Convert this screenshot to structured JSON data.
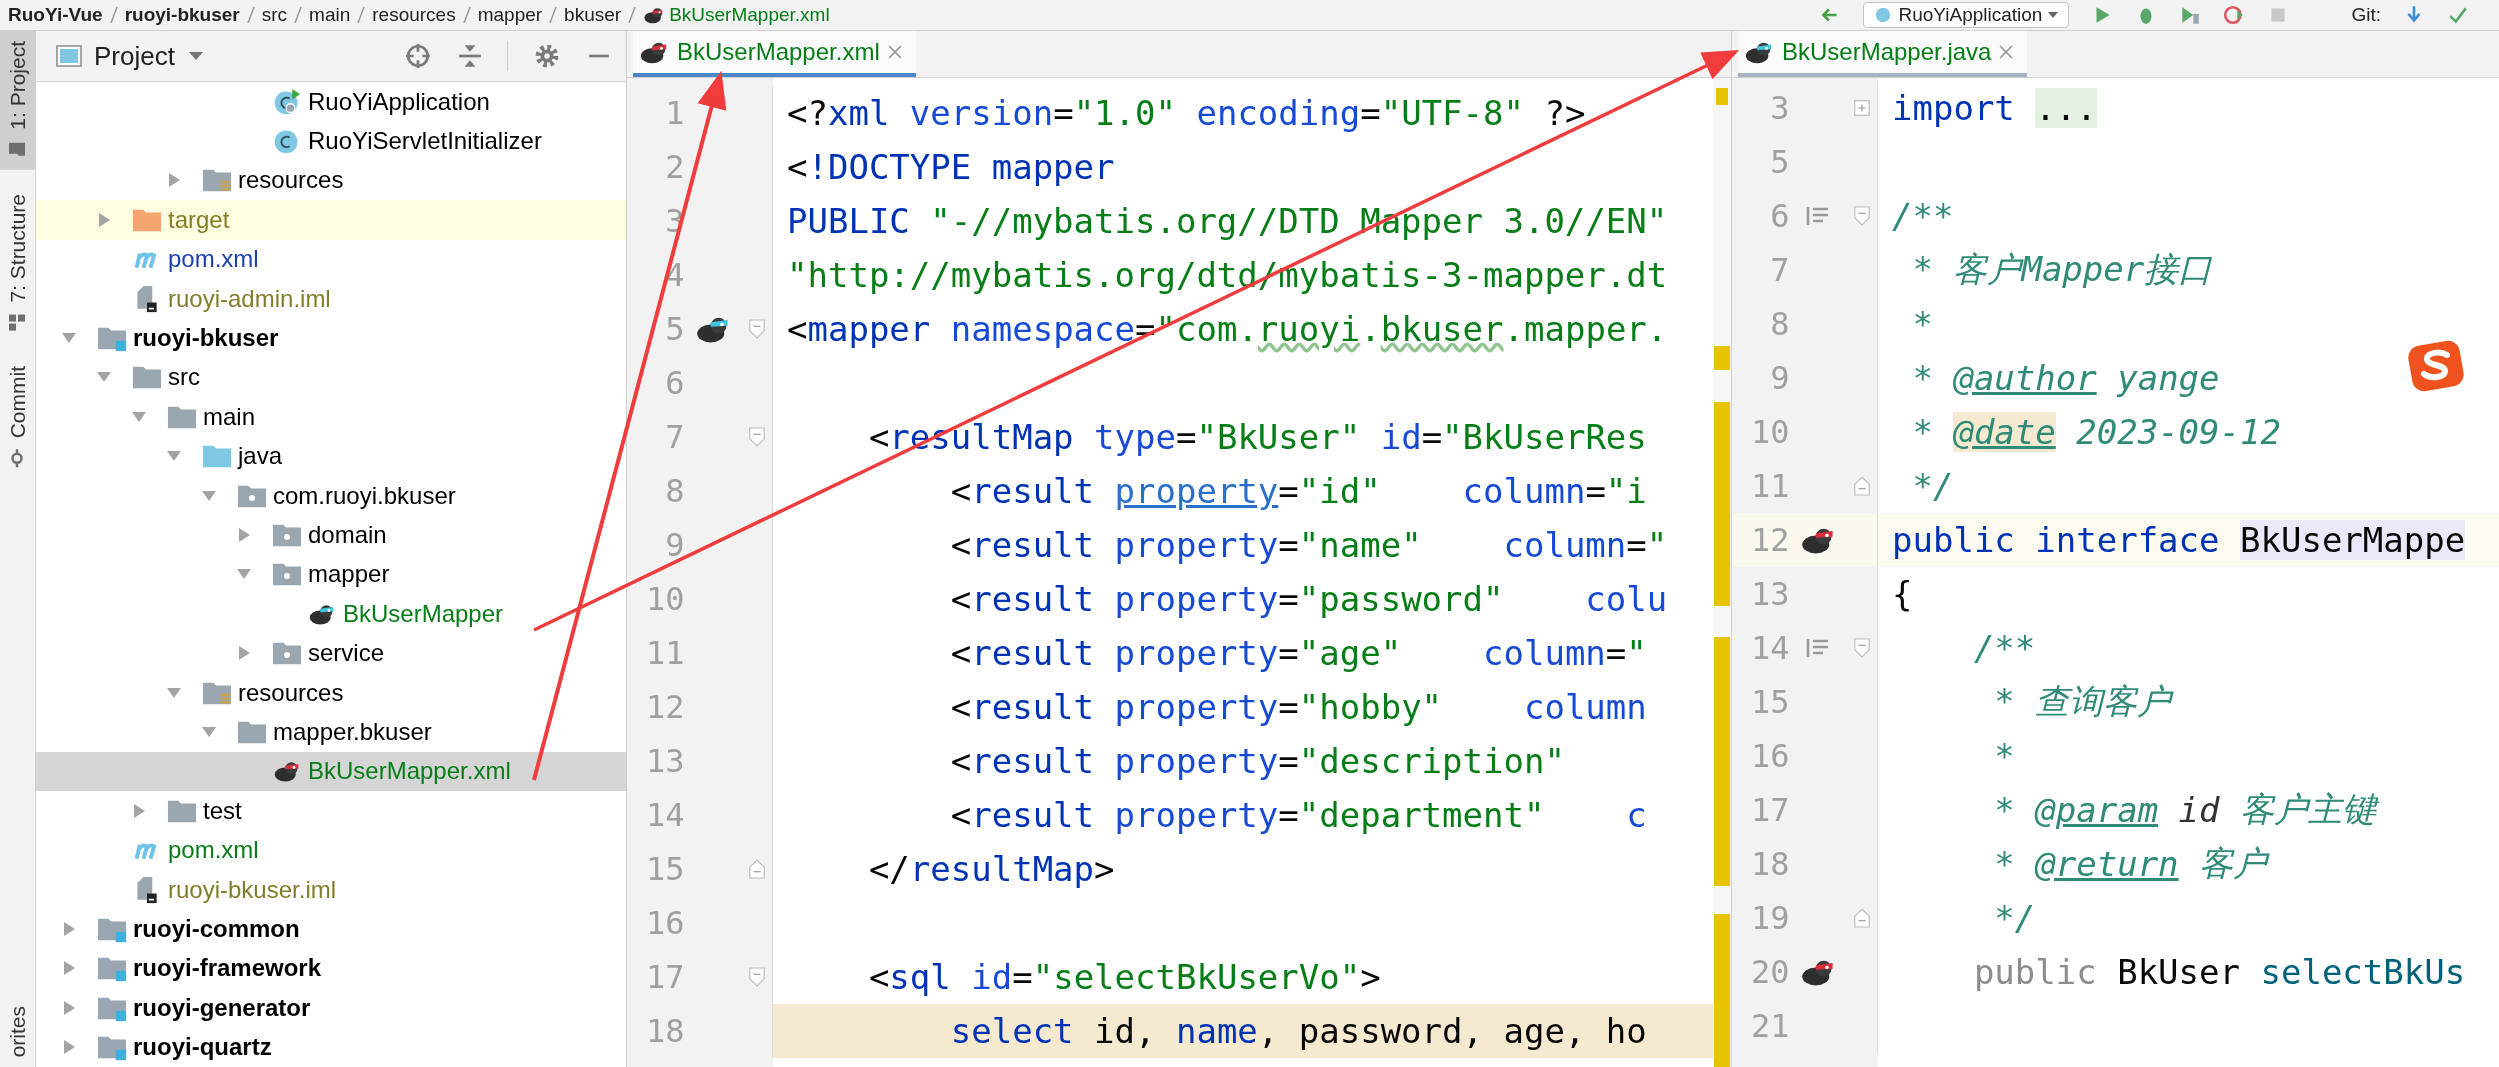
{
  "navbar": {
    "breadcrumbs": [
      {
        "label": "RuoYi-Vue",
        "kind": "project"
      },
      {
        "label": "ruoyi-bkuser",
        "kind": "module"
      },
      {
        "label": "src",
        "kind": "folder"
      },
      {
        "label": "main",
        "kind": "folder"
      },
      {
        "label": "resources",
        "kind": "folder"
      },
      {
        "label": "mapper",
        "kind": "folder"
      },
      {
        "label": "bkuser",
        "kind": "folder"
      },
      {
        "label": "BkUserMapper.xml",
        "kind": "file"
      }
    ],
    "run_config": "RuoYiApplication",
    "vcs_label": "Git:"
  },
  "tool_strip": [
    {
      "label": "1: Project",
      "kind": "project",
      "selected": true
    },
    {
      "label": "7: Structure",
      "kind": "structure",
      "selected": false
    },
    {
      "label": "Commit",
      "kind": "commit",
      "selected": false
    },
    {
      "label": "orites",
      "kind": "favorites",
      "selected": false
    }
  ],
  "project": {
    "title": "Project",
    "tree": [
      {
        "kind": "hidden",
        "children": [
          {
            "kind": "hidden",
            "children": [
              {
                "kind": "hidden",
                "children": [
                  {
                    "kind": "hidden",
                    "children": [
                      {
                        "kind": "hidden",
                        "children": [
                          {
                            "label": "RuoYiApplication",
                            "kind": "spring-class",
                            "color": "#000000",
                            "selected": false
                          },
                          {
                            "label": "RuoYiServletInitializer",
                            "kind": "class",
                            "color": "#000000",
                            "selected": false
                          }
                        ]
                      }
                    ]
                  },
                  {
                    "label": "resources",
                    "kind": "resources-folder",
                    "expanded": false,
                    "color": "#000000",
                    "selected": false
                  }
                ]
              }
            ]
          },
          {
            "label": "target",
            "kind": "excluded-folder",
            "expanded": false,
            "color": "#827d28",
            "selected": false
          },
          {
            "label": "pom.xml",
            "kind": "maven",
            "color": "#1a3fb0",
            "selected": false
          },
          {
            "label": "ruoyi-admin.iml",
            "kind": "iml",
            "color": "#827d28",
            "selected": false
          }
        ]
      },
      {
        "label": "ruoyi-bkuser",
        "kind": "module",
        "expanded": true,
        "color": "#000000",
        "selected": false,
        "children": [
          {
            "label": "src",
            "kind": "folder",
            "expanded": true,
            "color": "#000000",
            "selected": false,
            "children": [
              {
                "label": "main",
                "kind": "folder",
                "expanded": true,
                "color": "#000000",
                "selected": false,
                "children": [
                  {
                    "label": "java",
                    "kind": "source-folder",
                    "expanded": true,
                    "color": "#000000",
                    "selected": false,
                    "children": [
                      {
                        "label": "com.ruoyi.bkuser",
                        "kind": "package",
                        "expanded": true,
                        "color": "#000000",
                        "selected": false,
                        "children": [
                          {
                            "label": "domain",
                            "kind": "package",
                            "expanded": false,
                            "color": "#000000",
                            "selected": false
                          },
                          {
                            "label": "mapper",
                            "kind": "package",
                            "expanded": true,
                            "color": "#000000",
                            "selected": false,
                            "children": [
                              {
                                "label": "BkUserMapper",
                                "kind": "mybatis-java",
                                "color": "#067d17",
                                "selected": false
                              }
                            ]
                          },
                          {
                            "label": "service",
                            "kind": "package",
                            "expanded": false,
                            "color": "#000000",
                            "selected": false
                          }
                        ]
                      }
                    ]
                  },
                  {
                    "label": "resources",
                    "kind": "resources-folder",
                    "expanded": true,
                    "color": "#000000",
                    "selected": false,
                    "children": [
                      {
                        "label": "mapper.bkuser",
                        "kind": "folder",
                        "expanded": true,
                        "color": "#000000",
                        "selected": false,
                        "children": [
                          {
                            "label": "BkUserMapper.xml",
                            "kind": "mybatis-xml",
                            "color": "#067d17",
                            "selected": true
                          }
                        ]
                      }
                    ]
                  }
                ]
              },
              {
                "label": "test",
                "kind": "folder",
                "expanded": false,
                "color": "#000000",
                "selected": false
              }
            ]
          },
          {
            "label": "pom.xml",
            "kind": "maven",
            "color": "#067d17",
            "selected": false
          },
          {
            "label": "ruoyi-bkuser.iml",
            "kind": "iml",
            "color": "#827d28",
            "selected": false
          }
        ]
      },
      {
        "label": "ruoyi-common",
        "kind": "module",
        "expanded": false,
        "color": "#000000",
        "selected": false
      },
      {
        "label": "ruoyi-framework",
        "kind": "module",
        "expanded": false,
        "color": "#000000",
        "selected": false
      },
      {
        "label": "ruoyi-generator",
        "kind": "module",
        "expanded": false,
        "color": "#000000",
        "selected": false
      },
      {
        "label": "ruoyi-quartz",
        "kind": "module",
        "expanded": false,
        "color": "#000000",
        "selected": false
      }
    ]
  },
  "editors": [
    {
      "tab": {
        "label": "BkUserMapper.xml",
        "kind": "mybatis-xml",
        "color": "#067d17",
        "selected": true,
        "focused": true
      },
      "lines": [
        {
          "number": "1",
          "current": false,
          "injected": false,
          "tokens": [
            {
              "text": "<?",
              "kind": "punct"
            },
            {
              "text": "xml ",
              "kind": "tag"
            },
            {
              "text": "version",
              "kind": "attr"
            },
            {
              "text": "=",
              "kind": "punct"
            },
            {
              "text": "\"1.0\" ",
              "kind": "value"
            },
            {
              "text": "encoding",
              "kind": "attr"
            },
            {
              "text": "=",
              "kind": "punct"
            },
            {
              "text": "\"UTF-8\" ",
              "kind": "value"
            },
            {
              "text": "?>",
              "kind": "punct"
            }
          ]
        },
        {
          "number": "2",
          "current": false,
          "injected": false,
          "tokens": [
            {
              "text": "<",
              "kind": "punct"
            },
            {
              "text": "!DOCTYPE mapper",
              "kind": "tag"
            }
          ]
        },
        {
          "number": "3",
          "current": false,
          "injected": false,
          "tokens": [
            {
              "text": "PUBLIC ",
              "kind": "tag"
            },
            {
              "text": "\"-//mybatis.org//DTD Mapper 3.0//EN\"",
              "kind": "value"
            }
          ]
        },
        {
          "number": "4",
          "current": false,
          "injected": false,
          "tokens": [
            {
              "text": "\"http://mybatis.org/dtd/mybatis-3-mapper.dt",
              "kind": "value"
            }
          ]
        },
        {
          "number": "5",
          "current": false,
          "injected": false,
          "gutter_icon": {
            "kind": "mybatis-java"
          },
          "fold": {
            "kind": "start"
          },
          "tokens": [
            {
              "text": "<",
              "kind": "punct"
            },
            {
              "text": "mapper ",
              "kind": "tag"
            },
            {
              "text": "namespace",
              "kind": "attr"
            },
            {
              "text": "=",
              "kind": "punct"
            },
            {
              "text": "\"com.",
              "kind": "value"
            },
            {
              "text": "ruoyi",
              "kind": "value-typo"
            },
            {
              "text": ".",
              "kind": "value"
            },
            {
              "text": "bkuser",
              "kind": "value-typo"
            },
            {
              "text": ".mapper.",
              "kind": "value"
            }
          ]
        },
        {
          "number": "6",
          "current": false,
          "injected": false
        },
        {
          "number": "7",
          "current": false,
          "injected": false,
          "fold": {
            "kind": "start"
          },
          "tokens": [
            {
              "text": "    <",
              "kind": "punct"
            },
            {
              "text": "resultMap ",
              "kind": "tag"
            },
            {
              "text": "type",
              "kind": "attr"
            },
            {
              "text": "=",
              "kind": "punct"
            },
            {
              "text": "\"BkUser\" ",
              "kind": "value"
            },
            {
              "text": "id",
              "kind": "attr"
            },
            {
              "text": "=",
              "kind": "punct"
            },
            {
              "text": "\"BkUserRes",
              "kind": "value"
            }
          ]
        },
        {
          "number": "8",
          "current": false,
          "injected": false,
          "tokens": [
            {
              "text": "        <",
              "kind": "punct"
            },
            {
              "text": "result ",
              "kind": "tag"
            },
            {
              "text": "property",
              "kind": "attr-link"
            },
            {
              "text": "=",
              "kind": "punct"
            },
            {
              "text": "\"id\"    ",
              "kind": "value"
            },
            {
              "text": "column",
              "kind": "attr"
            },
            {
              "text": "=",
              "kind": "punct"
            },
            {
              "text": "\"i",
              "kind": "value"
            }
          ]
        },
        {
          "number": "9",
          "current": false,
          "injected": false,
          "tokens": [
            {
              "text": "        <",
              "kind": "punct"
            },
            {
              "text": "result ",
              "kind": "tag"
            },
            {
              "text": "property",
              "kind": "attr"
            },
            {
              "text": "=",
              "kind": "punct"
            },
            {
              "text": "\"name\"    ",
              "kind": "value"
            },
            {
              "text": "column",
              "kind": "attr"
            },
            {
              "text": "=",
              "kind": "punct"
            },
            {
              "text": "\"",
              "kind": "value"
            }
          ]
        },
        {
          "number": "10",
          "current": false,
          "injected": false,
          "tokens": [
            {
              "text": "        <",
              "kind": "punct"
            },
            {
              "text": "result ",
              "kind": "tag"
            },
            {
              "text": "property",
              "kind": "attr"
            },
            {
              "text": "=",
              "kind": "punct"
            },
            {
              "text": "\"password\"    ",
              "kind": "value"
            },
            {
              "text": "colu",
              "kind": "attr"
            }
          ]
        },
        {
          "number": "11",
          "current": false,
          "injected": false,
          "tokens": [
            {
              "text": "        <",
              "kind": "punct"
            },
            {
              "text": "result ",
              "kind": "tag"
            },
            {
              "text": "property",
              "kind": "attr"
            },
            {
              "text": "=",
              "kind": "punct"
            },
            {
              "text": "\"age\"    ",
              "kind": "value"
            },
            {
              "text": "column",
              "kind": "attr"
            },
            {
              "text": "=",
              "kind": "punct"
            },
            {
              "text": "\"",
              "kind": "value"
            }
          ]
        },
        {
          "number": "12",
          "current": false,
          "injected": false,
          "tokens": [
            {
              "text": "        <",
              "kind": "punct"
            },
            {
              "text": "result ",
              "kind": "tag"
            },
            {
              "text": "property",
              "kind": "attr"
            },
            {
              "text": "=",
              "kind": "punct"
            },
            {
              "text": "\"hobby\"    ",
              "kind": "value"
            },
            {
              "text": "column",
              "kind": "attr"
            }
          ]
        },
        {
          "number": "13",
          "current": false,
          "injected": false,
          "tokens": [
            {
              "text": "        <",
              "kind": "punct"
            },
            {
              "text": "result ",
              "kind": "tag"
            },
            {
              "text": "property",
              "kind": "attr"
            },
            {
              "text": "=",
              "kind": "punct"
            },
            {
              "text": "\"description\"",
              "kind": "value"
            }
          ]
        },
        {
          "number": "14",
          "current": false,
          "injected": false,
          "tokens": [
            {
              "text": "        <",
              "kind": "punct"
            },
            {
              "text": "result ",
              "kind": "tag"
            },
            {
              "text": "property",
              "kind": "attr"
            },
            {
              "text": "=",
              "kind": "punct"
            },
            {
              "text": "\"department\"    ",
              "kind": "value"
            },
            {
              "text": "c",
              "kind": "attr"
            }
          ]
        },
        {
          "number": "15",
          "current": false,
          "injected": false,
          "fold": {
            "kind": "end"
          },
          "tokens": [
            {
              "text": "    </",
              "kind": "punct"
            },
            {
              "text": "resultMap",
              "kind": "tag"
            },
            {
              "text": ">",
              "kind": "punct"
            }
          ]
        },
        {
          "number": "16",
          "current": false,
          "injected": false
        },
        {
          "number": "17",
          "current": false,
          "injected": false,
          "fold": {
            "kind": "start"
          },
          "tokens": [
            {
              "text": "    <",
              "kind": "punct"
            },
            {
              "text": "sql ",
              "kind": "tag"
            },
            {
              "text": "id",
              "kind": "attr"
            },
            {
              "text": "=",
              "kind": "punct"
            },
            {
              "text": "\"selectBkUserVo\"",
              "kind": "value"
            },
            {
              "text": ">",
              "kind": "punct"
            }
          ]
        },
        {
          "number": "18",
          "current": false,
          "injected": true,
          "tokens": [
            {
              "text": "        select ",
              "kind": "sqlkw"
            },
            {
              "text": "id, ",
              "kind": "plain"
            },
            {
              "text": "name",
              "kind": "sqlkw"
            },
            {
              "text": ", password, age, ho",
              "kind": "plain"
            }
          ]
        }
      ]
    },
    {
      "tab": {
        "label": "BkUserMapper.java",
        "kind": "mybatis-java",
        "color": "#067d17",
        "selected": true,
        "focused": false
      },
      "lines": [
        {
          "number": "3",
          "current": false,
          "fold": {
            "kind": "collapsed"
          },
          "tokens": [
            {
              "text": "import ",
              "kind": "keyword"
            },
            {
              "text": "...",
              "kind": "plain-folded"
            }
          ]
        },
        {
          "number": "5",
          "current": false
        },
        {
          "number": "6",
          "current": false,
          "gutter_icon": {
            "kind": "doc"
          },
          "fold": {
            "kind": "start"
          },
          "tokens": [
            {
              "text": "/**",
              "kind": "doc"
            }
          ]
        },
        {
          "number": "7",
          "current": false,
          "tokens": [
            {
              "text": " * 客户Mapper接口",
              "kind": "doc"
            }
          ]
        },
        {
          "number": "8",
          "current": false,
          "tokens": [
            {
              "text": " *",
              "kind": "doc"
            }
          ]
        },
        {
          "number": "9",
          "current": false,
          "tokens": [
            {
              "text": " * ",
              "kind": "doc"
            },
            {
              "text": "@author",
              "kind": "doctag"
            },
            {
              "text": " yange",
              "kind": "doc"
            }
          ]
        },
        {
          "number": "10",
          "current": false,
          "tokens": [
            {
              "text": " * ",
              "kind": "doc"
            },
            {
              "text": "@date",
              "kind": "doctag-match"
            },
            {
              "text": " 2023-09-12",
              "kind": "doc"
            }
          ]
        },
        {
          "number": "11",
          "current": false,
          "fold": {
            "kind": "end"
          },
          "tokens": [
            {
              "text": " */",
              "kind": "doc"
            }
          ]
        },
        {
          "number": "12",
          "current": true,
          "gutter_icon": {
            "kind": "mybatis-xml"
          },
          "tokens": [
            {
              "text": "public interface ",
              "kind": "keyword"
            },
            {
              "text": "BkUserMappe",
              "kind": "plain-identifier"
            }
          ]
        },
        {
          "number": "13",
          "current": false,
          "tokens": [
            {
              "text": "{",
              "kind": "plain"
            }
          ]
        },
        {
          "number": "14",
          "current": false,
          "gutter_icon": {
            "kind": "doc"
          },
          "fold": {
            "kind": "start"
          },
          "tokens": [
            {
              "text": "    /**",
              "kind": "doc"
            }
          ]
        },
        {
          "number": "15",
          "current": false,
          "tokens": [
            {
              "text": "     * 查询客户",
              "kind": "doc"
            }
          ]
        },
        {
          "number": "16",
          "current": false,
          "tokens": [
            {
              "text": "     *",
              "kind": "doc"
            }
          ]
        },
        {
          "number": "17",
          "current": false,
          "tokens": [
            {
              "text": "     * ",
              "kind": "doc"
            },
            {
              "text": "@param",
              "kind": "doctag"
            },
            {
              "text": " id",
              "kind": "docparam"
            },
            {
              "text": " 客户主键",
              "kind": "doc"
            }
          ]
        },
        {
          "number": "18",
          "current": false,
          "tokens": [
            {
              "text": "     * ",
              "kind": "doc"
            },
            {
              "text": "@return",
              "kind": "doctag"
            },
            {
              "text": " 客户",
              "kind": "doc"
            }
          ]
        },
        {
          "number": "19",
          "current": false,
          "fold": {
            "kind": "end"
          },
          "tokens": [
            {
              "text": "     */",
              "kind": "doc"
            }
          ]
        },
        {
          "number": "20",
          "current": false,
          "gutter_icon": {
            "kind": "mybatis-xml"
          },
          "tokens": [
            {
              "text": "    public ",
              "kind": "muted"
            },
            {
              "text": "BkUser ",
              "kind": "plain"
            },
            {
              "text": "selectBkUs",
              "kind": "method"
            }
          ]
        },
        {
          "number": "21",
          "current": false
        }
      ]
    }
  ]
}
